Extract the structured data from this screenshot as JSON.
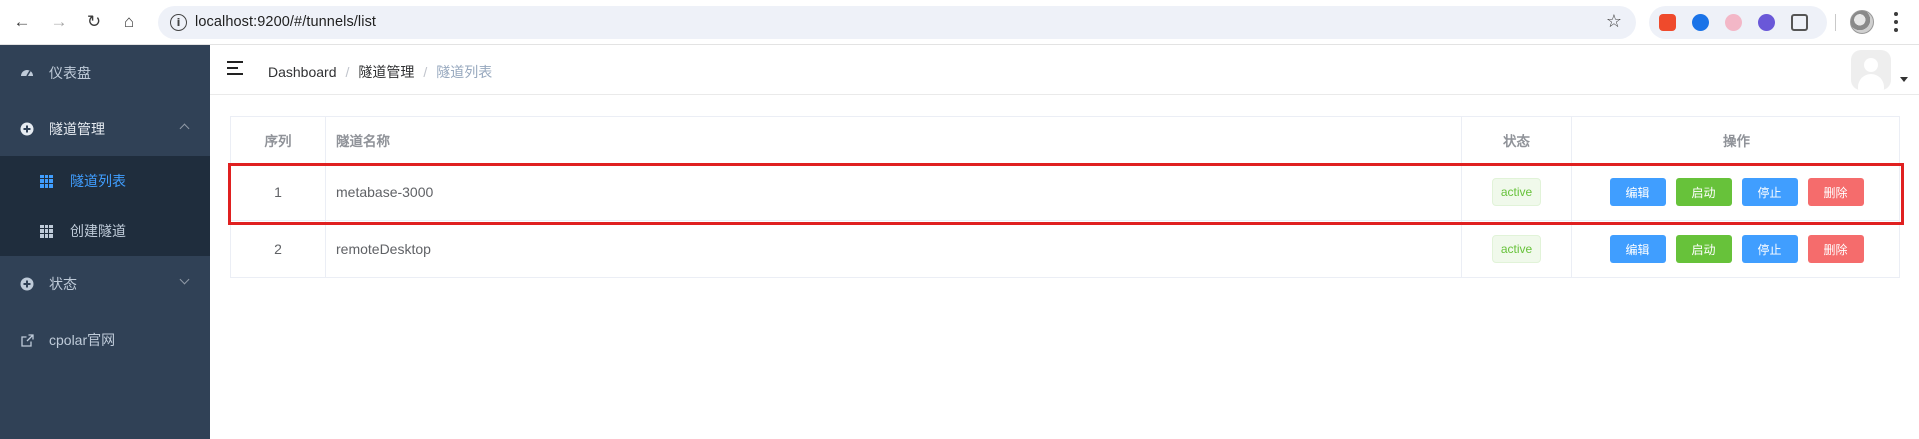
{
  "browser": {
    "url": "localhost:9200/#/tunnels/list"
  },
  "sidebar": {
    "items": [
      {
        "label": "仪表盘",
        "icon": "dashboard-icon"
      },
      {
        "label": "隧道管理",
        "icon": "tunnel-icon",
        "expanded": true
      },
      {
        "label": "状态",
        "icon": "status-icon",
        "expanded": false
      },
      {
        "label": "cpolar官网",
        "icon": "external-link-icon"
      }
    ],
    "sub_items": [
      {
        "label": "隧道列表",
        "icon": "grid-icon",
        "active": true
      },
      {
        "label": "创建隧道",
        "icon": "grid-icon",
        "active": false
      }
    ]
  },
  "breadcrumb": {
    "items": [
      "Dashboard",
      "隧道管理",
      "隧道列表"
    ],
    "separator": "/"
  },
  "table": {
    "headers": [
      "序列",
      "隧道名称",
      "状态",
      "操作"
    ],
    "rows": [
      {
        "index": "1",
        "name": "metabase-3000",
        "status": "active"
      },
      {
        "index": "2",
        "name": "remoteDesktop",
        "status": "active"
      }
    ],
    "actions": {
      "edit": "编辑",
      "start": "启动",
      "stop": "停止",
      "delete": "删除"
    }
  },
  "colors": {
    "sidebar_bg": "#304156",
    "submenu_bg": "#1f2d3d",
    "primary": "#409eff",
    "success": "#67c23a",
    "danger": "#f56c6c",
    "highlight": "#e02020"
  }
}
